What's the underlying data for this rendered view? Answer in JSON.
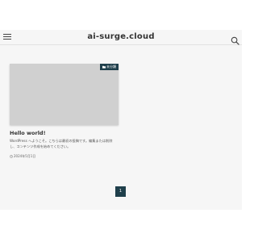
{
  "header": {
    "site_title": "ai-surge.cloud",
    "menu_icon": "hamburger-icon",
    "search_icon": "search-icon"
  },
  "post": {
    "category": "未分類",
    "category_icon": "folder-icon",
    "title": "Hello world!",
    "excerpt": "WordPress へようこそ。こちらは最初の投稿です。編集または削除し、コンテンツ作成を始めてください。",
    "date": "2024年5月1日",
    "date_icon": "clock-icon"
  },
  "pagination": {
    "current_page": "1"
  },
  "colors": {
    "accent": "#1f3f4b",
    "header_bg": "#f6f6f6",
    "thumbnail": "#d0d0d0"
  }
}
